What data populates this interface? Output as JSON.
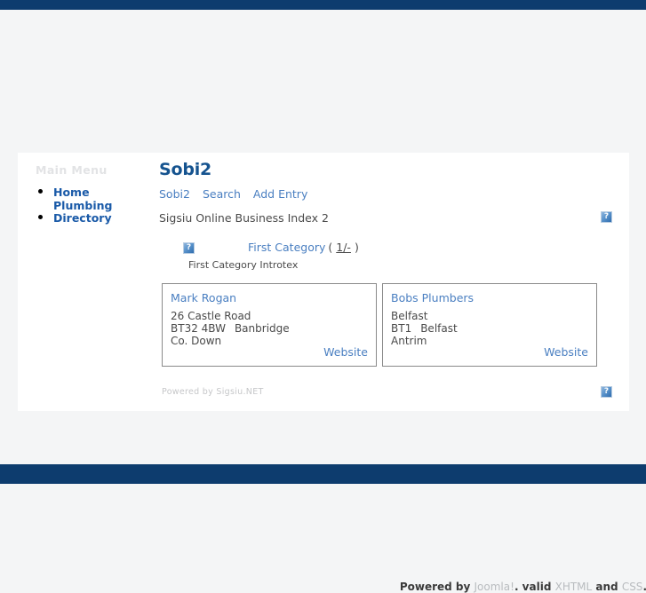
{
  "theme": {
    "chrome_bar_color": "#0d3c6e",
    "page_bg": "#f4f5f6",
    "content_bg": "#ffffff",
    "heading_color": "#15538f",
    "link_color": "#4a7fc1",
    "menu_link_color": "#1a5aa8",
    "muted_text": "#4a4a4a",
    "card_border": "#8a8a8a"
  },
  "sidebar": {
    "module_title": "Main Menu",
    "items": [
      {
        "label": "Home"
      },
      {
        "label": "Plumbing Directory"
      }
    ]
  },
  "component": {
    "title": "Sobi2",
    "nav": [
      {
        "label": "Sobi2"
      },
      {
        "label": "Search"
      },
      {
        "label": "Add Entry"
      }
    ],
    "description": "Sigsiu Online Business Index 2",
    "header_icon": "broken-image-icon",
    "category": {
      "icon": "broken-image-icon",
      "name": "First Category",
      "count_prefix": "(",
      "count": "1/-",
      "count_suffix": ")",
      "intro": "First Category Introtex"
    },
    "entries": [
      {
        "title": "Mark Rogan",
        "address_line1": "26 Castle Road",
        "postcode": "BT32 4BW",
        "city": "Banbridge",
        "region": "Co. Down",
        "website_label": "Website"
      },
      {
        "title": "Bobs Plumbers",
        "address_line1": "Belfast",
        "postcode": "BT1",
        "city": "Belfast",
        "region": "Antrim",
        "website_label": "Website"
      }
    ],
    "powered_by": "Powered by Sigsiu.NET",
    "footer_icon": "broken-image-icon"
  },
  "site_footer": {
    "prefix": "Powered by ",
    "joomla_label": "Joomla!",
    "middle": ". valid ",
    "xhtml_label": "XHTML",
    "and": " and ",
    "css_label": "CSS",
    "suffix": "."
  }
}
